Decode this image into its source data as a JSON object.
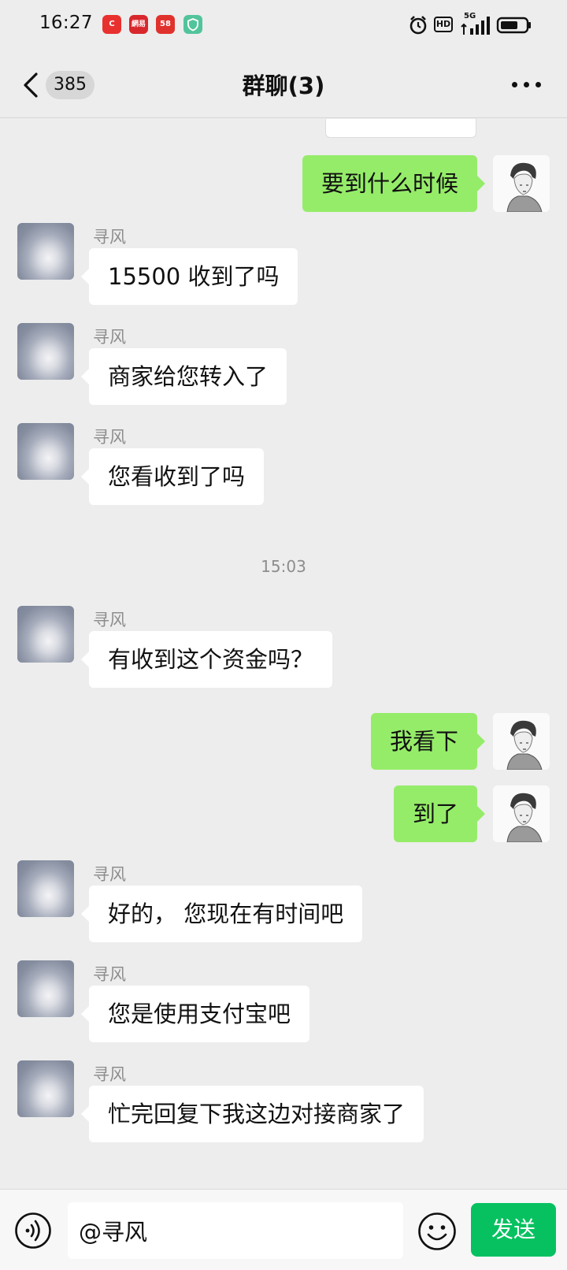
{
  "status_bar": {
    "time": "16:27",
    "apps": [
      {
        "icon": "c-app-icon",
        "label": "C",
        "color": "#e8312f"
      },
      {
        "icon": "netease-icon",
        "label": "網易",
        "color": "#d8272d"
      },
      {
        "icon": "app-58-icon",
        "label": "58",
        "color": "#e0322c"
      },
      {
        "icon": "shield-app-icon",
        "label": "",
        "color": "#52c49b"
      }
    ],
    "hd": "HD",
    "network": "5G",
    "battery_level": 0.7
  },
  "header": {
    "unread_count": "385",
    "title": "群聊(3)"
  },
  "chat": {
    "timestamp": "15:03",
    "messages": [
      {
        "dir": "out",
        "text": "要到什么时候"
      },
      {
        "dir": "in",
        "sender": "寻风",
        "text": "15500 收到了吗"
      },
      {
        "dir": "in",
        "sender": "寻风",
        "text": "商家给您转入了"
      },
      {
        "dir": "in",
        "sender": "寻风",
        "text": "您看收到了吗"
      },
      {
        "dir": "in",
        "sender": "寻风",
        "text": "有收到这个资金吗？"
      },
      {
        "dir": "out",
        "text": "我看下"
      },
      {
        "dir": "out",
        "text": "到了"
      },
      {
        "dir": "in",
        "sender": "寻风",
        "text": "好的， 您现在有时间吧"
      },
      {
        "dir": "in",
        "sender": "寻风",
        "text": "您是使用支付宝吧"
      },
      {
        "dir": "in",
        "sender": "寻风",
        "text": "忙完回复下我这边对接商家了"
      }
    ]
  },
  "input_bar": {
    "value": "@寻风",
    "send_label": "发送"
  },
  "colors": {
    "background": "#ededed",
    "outgoing_bubble": "#95ec69",
    "incoming_bubble": "#ffffff",
    "send_button": "#07c160"
  }
}
